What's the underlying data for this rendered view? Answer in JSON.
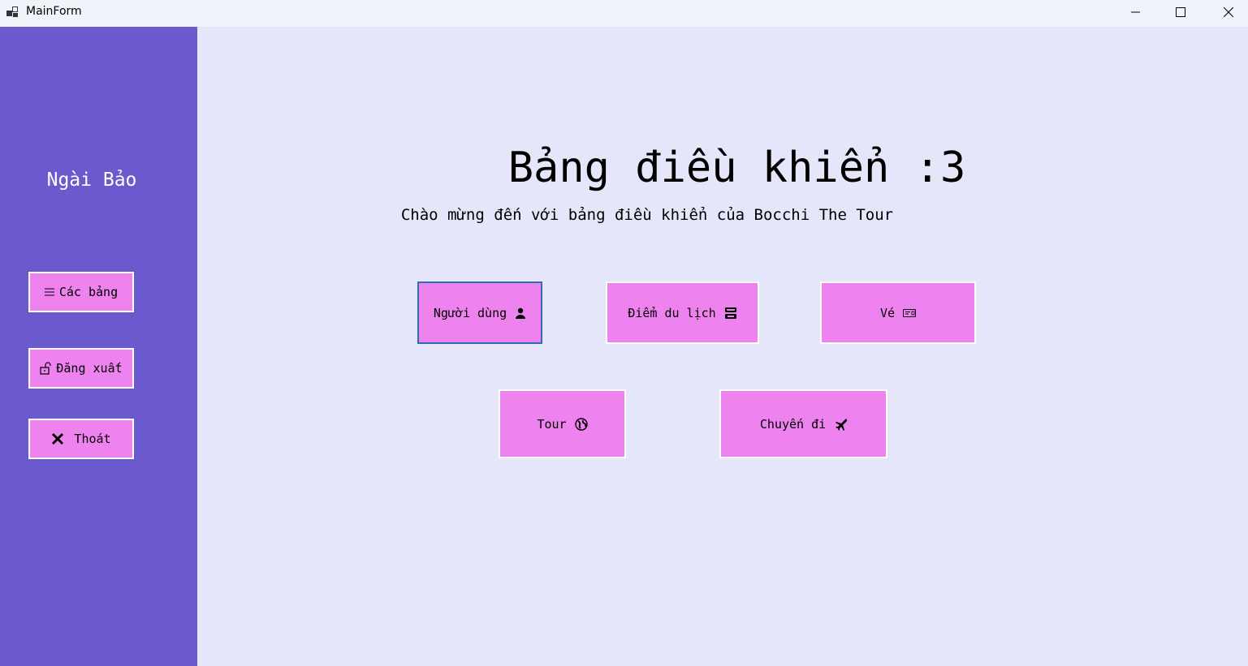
{
  "window": {
    "title": "MainForm",
    "controls": {
      "minimize_icon": "minimize-icon",
      "maximize_icon": "maximize-icon",
      "close_icon": "close-icon"
    }
  },
  "sidebar": {
    "user_name": "Ngài Bảo",
    "buttons": [
      {
        "label": "Các bảng",
        "icon": "menu-icon"
      },
      {
        "label": "Đăng xuất",
        "icon": "unlock-icon"
      },
      {
        "label": "Thoát",
        "icon": "close-x-icon"
      }
    ]
  },
  "main": {
    "title": "Bảng điều khiển :3",
    "subtitle": "Chào mừng đến với bảng điều khiển của Bocchi The Tour",
    "tiles": [
      {
        "label": "Người dùng",
        "icon": "user-icon"
      },
      {
        "label": "Điểm du lịch",
        "icon": "destination-icon"
      },
      {
        "label": "Vé",
        "icon": "ticket-icon"
      },
      {
        "label": "Tour",
        "icon": "globe-icon"
      },
      {
        "label": "Chuyến đi",
        "icon": "airplane-icon"
      }
    ]
  },
  "colors": {
    "sidebar_bg": "#6a5acd",
    "main_bg": "#e6e6fa",
    "button_bg": "#ee82ee",
    "titlebar_bg": "#eff3fa"
  }
}
